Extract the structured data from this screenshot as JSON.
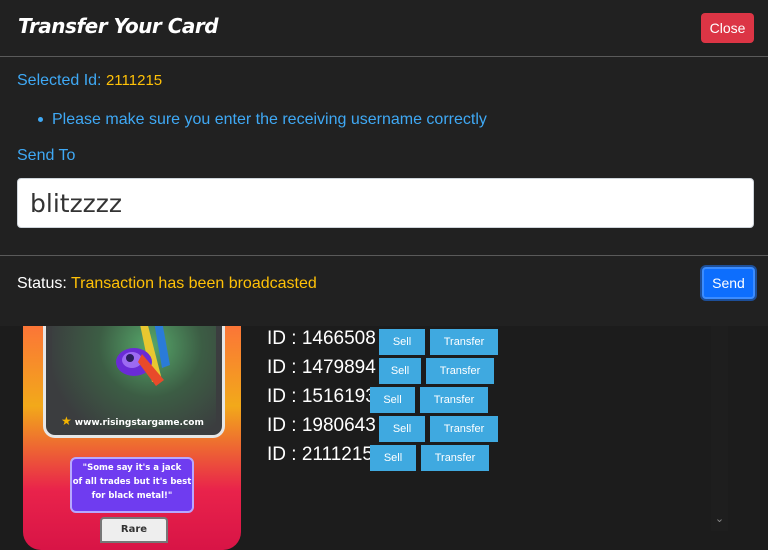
{
  "modal": {
    "title": "Transfer Your Card",
    "close_label": "Close",
    "selected_id_label": "Selected Id:",
    "selected_id_value": "2111215",
    "notice": "Please make sure you enter the receiving username correctly",
    "send_to_label": "Send To",
    "username_value": "blitzzzz",
    "status_label": "Status:",
    "status_value": "Transaction has been broadcasted",
    "send_label": "Send"
  },
  "card": {
    "url": "www.risingstargame.com",
    "quote_line1": "\"Some say it's a jack",
    "quote_line2": "of all trades but it's best",
    "quote_line3": "for black metal!\"",
    "rarity": "Rare"
  },
  "cards_list": [
    {
      "id": "1466508",
      "sell": "Sell",
      "transfer": "Transfer"
    },
    {
      "id": "1479894",
      "sell": "Sell",
      "transfer": "Transfer"
    },
    {
      "id": "1516193",
      "sell": "Sell",
      "transfer": "Transfer"
    },
    {
      "id": "1980643",
      "sell": "Sell",
      "transfer": "Transfer"
    },
    {
      "id": "2111215",
      "sell": "Sell",
      "transfer": "Transfer"
    }
  ],
  "colors": {
    "accent_blue": "#3fa9f5",
    "status_yellow": "#ffc107",
    "close_red": "#dc3545",
    "send_blue": "#0d6efd",
    "list_button_blue": "#3fa9e0"
  }
}
